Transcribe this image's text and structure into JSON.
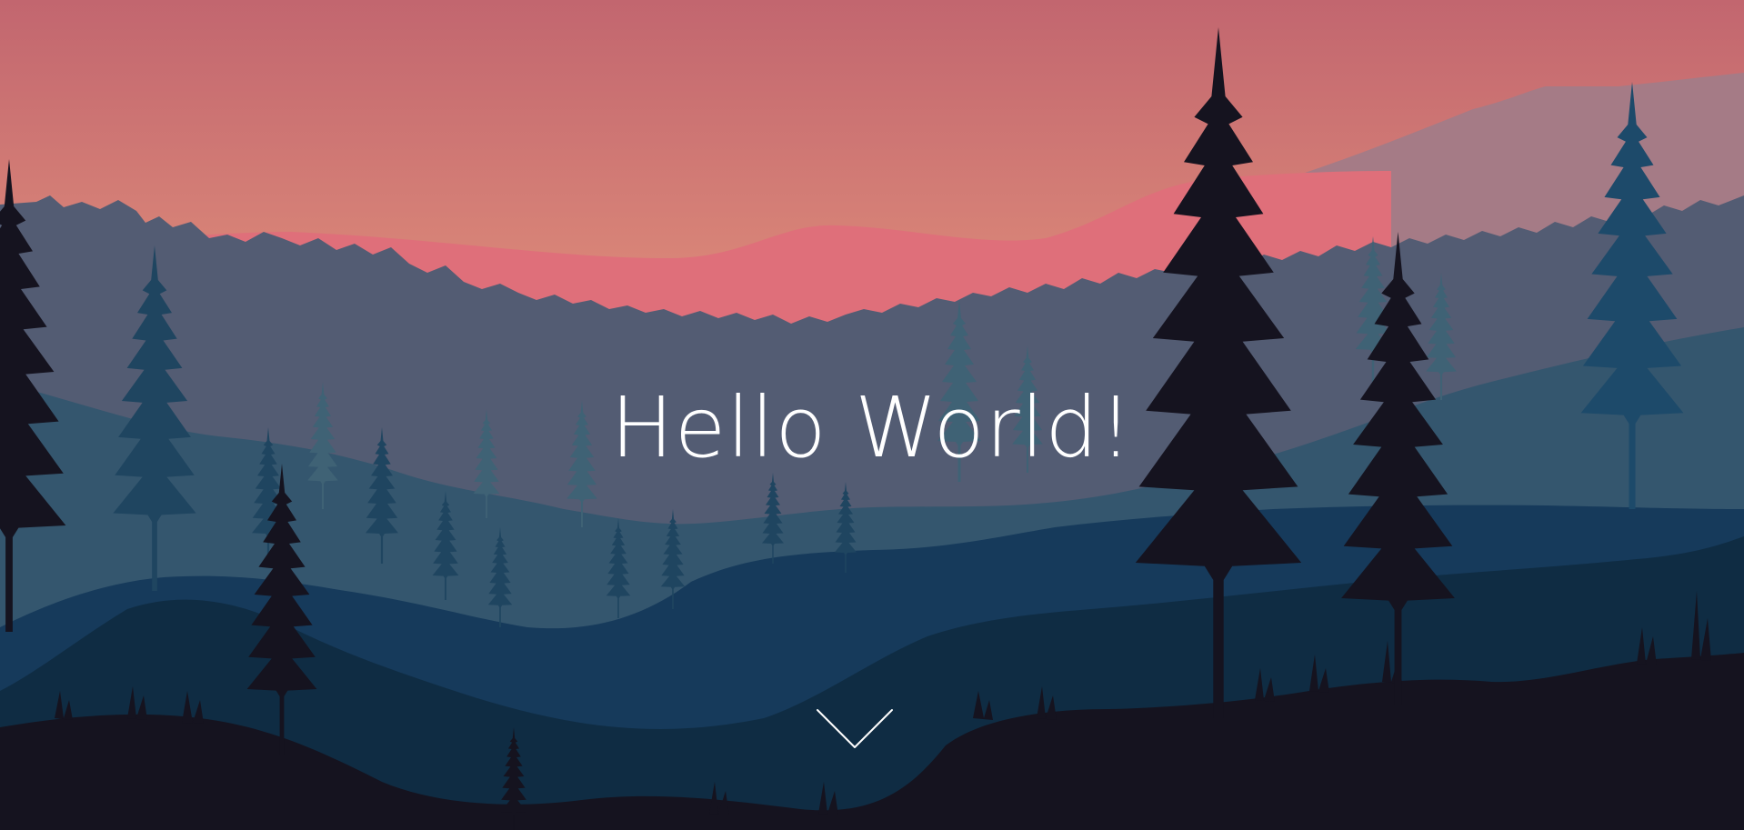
{
  "hero": {
    "title": "Hello World!",
    "scroll_icon": "chevron-down-icon",
    "background": "forest-sunset-landscape"
  },
  "colors": {
    "sky_top": "#c2666f",
    "sky_bottom": "#f8bc8c",
    "pink_hill": "#df6f7a",
    "mauve_mountain": "#a57b86",
    "far_forest": "#535c73",
    "mid_forest": "#34566e",
    "blue_hills": "#163a5b",
    "dark_hills": "#0f2c43",
    "foreground": "#15131f",
    "title_text": "#ffffff"
  }
}
